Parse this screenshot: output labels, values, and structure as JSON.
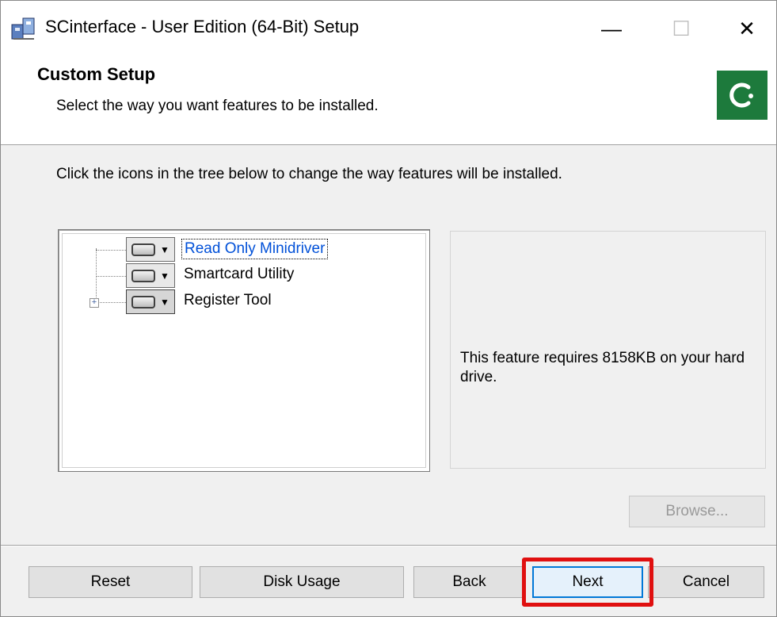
{
  "window": {
    "title": "SCinterface - User Edition (64-Bit) Setup",
    "controls": {
      "minimize": "—",
      "maximize": "☐",
      "close": "✕"
    }
  },
  "header": {
    "title": "Custom Setup",
    "subtitle": "Select the way you want features to be installed.",
    "logo_color": "#1d7a3c"
  },
  "instruction": "Click the icons in the tree below to change the way features will be installed.",
  "tree": {
    "items": [
      {
        "label": "Read Only Minidriver",
        "selected": true,
        "expandable": false
      },
      {
        "label": "Smartcard Utility",
        "selected": false,
        "expandable": false
      },
      {
        "label": "Register Tool",
        "selected": false,
        "expandable": true
      }
    ],
    "expander_symbol": "+"
  },
  "description": {
    "text": "This feature requires 8158KB on your hard drive."
  },
  "buttons": {
    "browse": "Browse...",
    "reset": "Reset",
    "disk_usage": "Disk Usage",
    "back": "Back",
    "next": "Next",
    "cancel": "Cancel"
  },
  "colors": {
    "highlight": "#e01010",
    "selection_text": "#0050d8",
    "default_button_border": "#0078d7"
  }
}
